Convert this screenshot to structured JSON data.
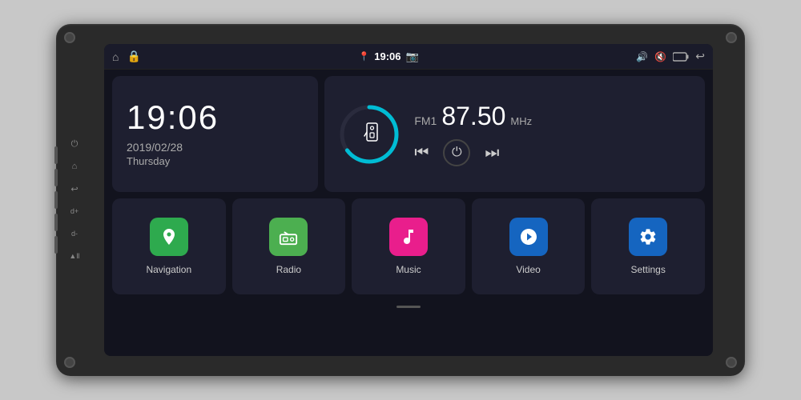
{
  "device": {
    "background_color": "#2a2a2a"
  },
  "status_bar": {
    "left_icons": [
      "home",
      "lock"
    ],
    "center_icons": [
      "location",
      "time",
      "camera"
    ],
    "time": "19:06",
    "right_icons": [
      "volume",
      "mute",
      "battery",
      "back"
    ]
  },
  "clock": {
    "time": "19:06",
    "date": "2019/02/28",
    "day": "Thursday"
  },
  "radio": {
    "band": "FM1",
    "frequency": "87.50",
    "unit": "MHz",
    "progress_color": "#00bcd4",
    "arc_pct": 65
  },
  "apps": [
    {
      "id": "navigation",
      "label": "Navigation",
      "icon": "📍",
      "color": "#2eaa4e"
    },
    {
      "id": "radio",
      "label": "Radio",
      "icon": "📻",
      "color": "#4caf50"
    },
    {
      "id": "music",
      "label": "Music",
      "icon": "🎵",
      "color": "#e91e8c"
    },
    {
      "id": "video",
      "label": "Video",
      "icon": "📽",
      "color": "#1565c0"
    },
    {
      "id": "settings",
      "label": "Settings",
      "icon": "⚙",
      "color": "#1565c0"
    }
  ],
  "side_icons": [
    "⏻",
    "⌂",
    "↩",
    "🔊+",
    "🔊-",
    "⏏"
  ]
}
